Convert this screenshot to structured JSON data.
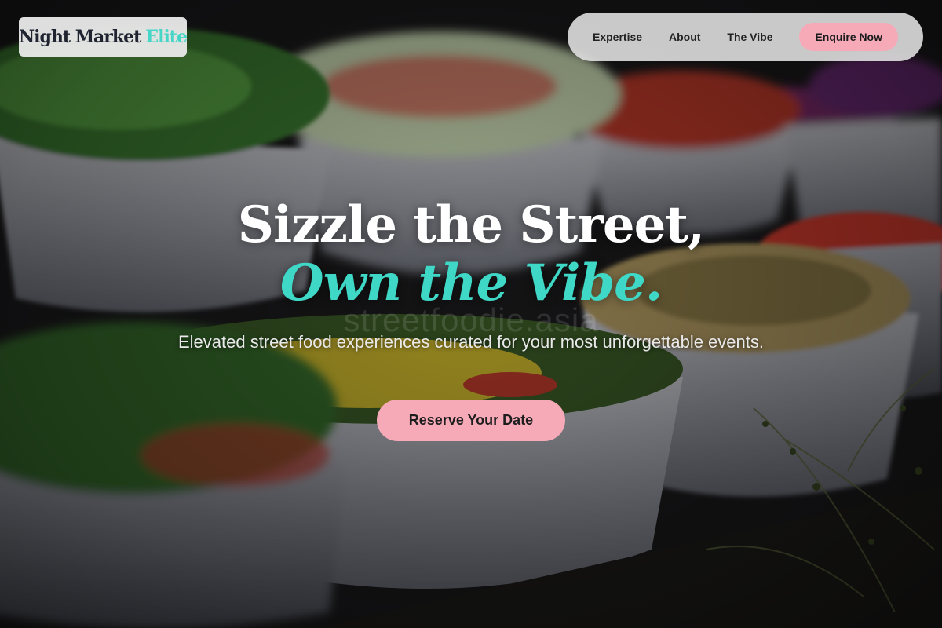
{
  "header": {
    "logo": {
      "text": "Night Market",
      "accent": "Elite"
    },
    "nav": {
      "links": [
        "Expertise",
        "About",
        "The Vibe"
      ],
      "cta": "Enquire Now"
    }
  },
  "hero": {
    "title_line1": "Sizzle the Street,",
    "title_line2": "Own the Vibe.",
    "subtitle": "Elevated street food experiences curated for your most unforgettable events.",
    "cta": "Reserve Your Date",
    "background_watermark": "streetfoodie.asia"
  },
  "colors": {
    "accent_teal": "#3fd8c7",
    "accent_pink": "#f6aab8",
    "nav_background": "#e4e4e4"
  }
}
